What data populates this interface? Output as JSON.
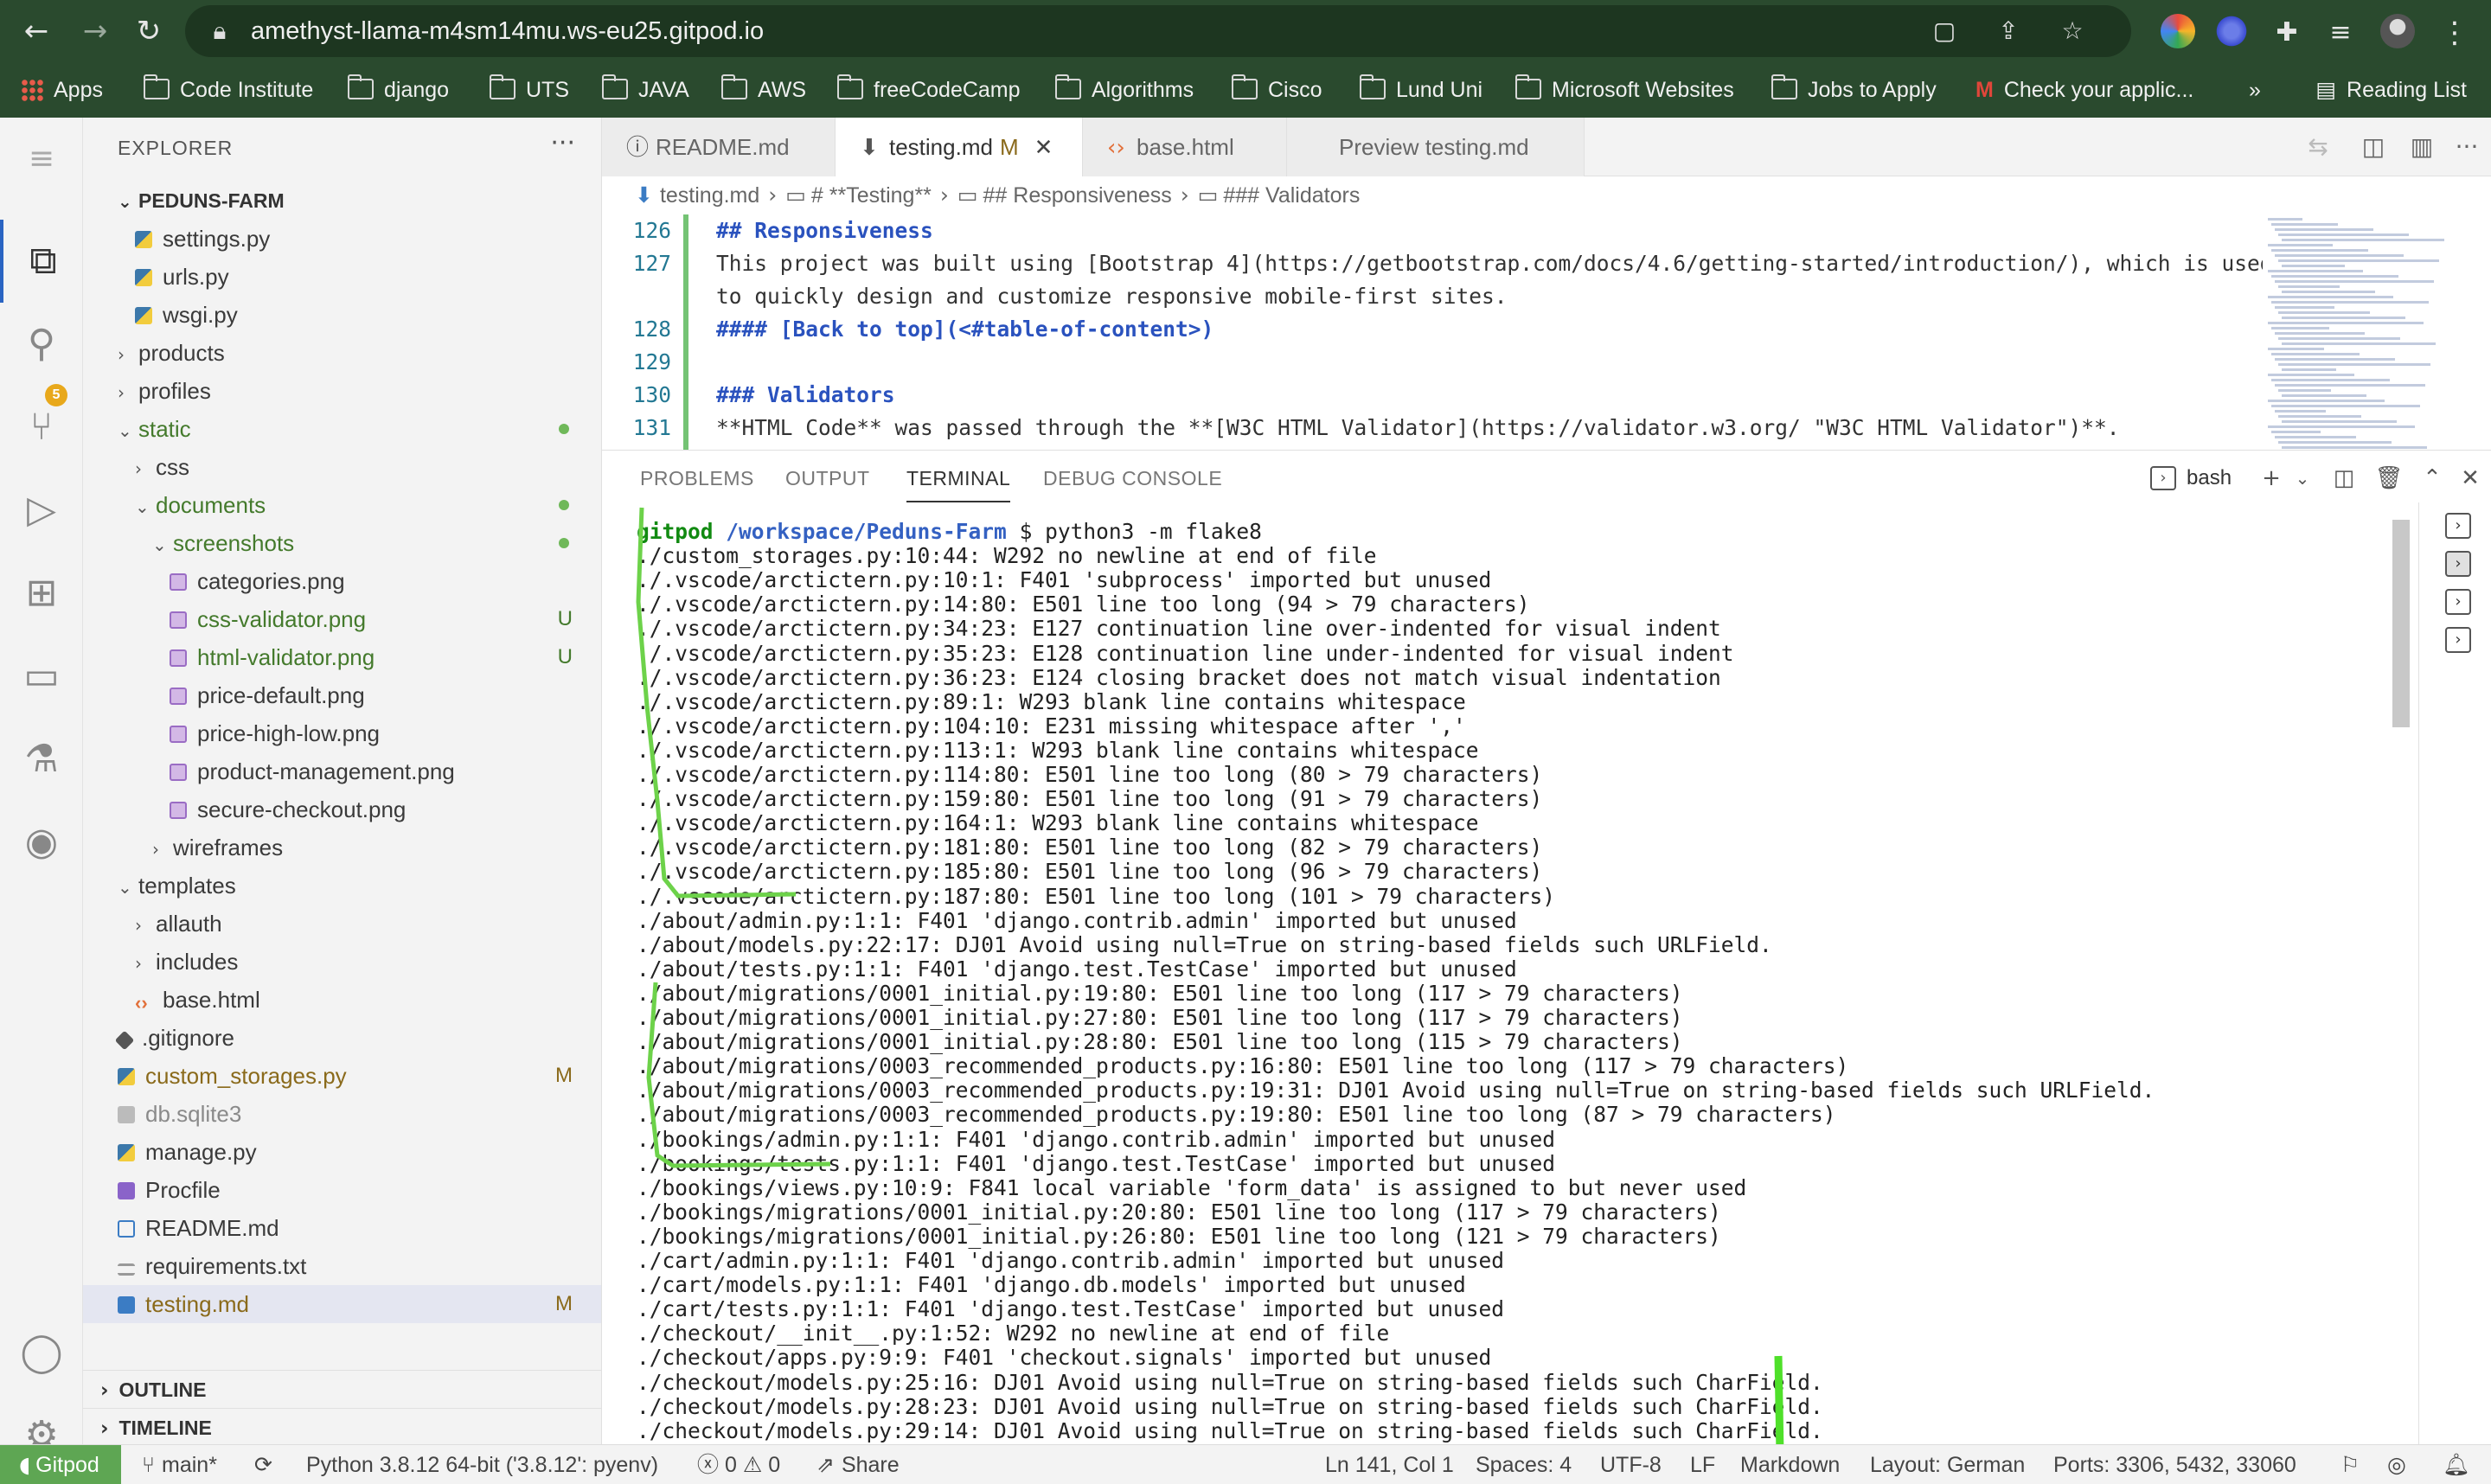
{
  "browser": {
    "url": "amethyst-llama-m4sm14mu.ws-eu25.gitpod.io",
    "bookmarks": [
      "Apps",
      "Code Institute",
      "django",
      "UTS",
      "JAVA",
      "AWS",
      "freeCodeCamp",
      "Algorithms",
      "Cisco",
      "Lund Uni",
      "Microsoft Websites",
      "Jobs to Apply",
      "Check your applic..."
    ],
    "overflow": "»",
    "reading_list": "Reading List"
  },
  "activity_bar": {
    "scm_badge": "5"
  },
  "explorer": {
    "title": "EXPLORER",
    "project": "PEDUNS-FARM",
    "rows": [
      {
        "label": "settings.py",
        "indent": 1,
        "icon": "py",
        "chev": ""
      },
      {
        "label": "urls.py",
        "indent": 1,
        "icon": "py",
        "chev": ""
      },
      {
        "label": "wsgi.py",
        "indent": 1,
        "icon": "py",
        "chev": ""
      },
      {
        "label": "products",
        "indent": 0,
        "icon": "",
        "chev": "›"
      },
      {
        "label": "profiles",
        "indent": 0,
        "icon": "",
        "chev": "›"
      },
      {
        "label": "static",
        "indent": 0,
        "icon": "",
        "chev": "⌄",
        "color": "green",
        "dot": true
      },
      {
        "label": "css",
        "indent": 1,
        "icon": "",
        "chev": "›"
      },
      {
        "label": "documents",
        "indent": 1,
        "icon": "",
        "chev": "⌄",
        "color": "green",
        "dot": true
      },
      {
        "label": "screenshots",
        "indent": 2,
        "icon": "",
        "chev": "⌄",
        "color": "green",
        "dot": true
      },
      {
        "label": "categories.png",
        "indent": 3,
        "icon": "img",
        "chev": ""
      },
      {
        "label": "css-validator.png",
        "indent": 3,
        "icon": "img",
        "chev": "",
        "color": "green",
        "badge": "U"
      },
      {
        "label": "html-validator.png",
        "indent": 3,
        "icon": "img",
        "chev": "",
        "color": "green",
        "badge": "U"
      },
      {
        "label": "price-default.png",
        "indent": 3,
        "icon": "img",
        "chev": ""
      },
      {
        "label": "price-high-low.png",
        "indent": 3,
        "icon": "img",
        "chev": ""
      },
      {
        "label": "product-management.png",
        "indent": 3,
        "icon": "img",
        "chev": ""
      },
      {
        "label": "secure-checkout.png",
        "indent": 3,
        "icon": "img",
        "chev": ""
      },
      {
        "label": "wireframes",
        "indent": 2,
        "icon": "",
        "chev": "›"
      },
      {
        "label": "templates",
        "indent": 0,
        "icon": "",
        "chev": "⌄"
      },
      {
        "label": "allauth",
        "indent": 1,
        "icon": "",
        "chev": "›"
      },
      {
        "label": "includes",
        "indent": 1,
        "icon": "",
        "chev": "›"
      },
      {
        "label": "base.html",
        "indent": 1,
        "icon": "html",
        "chev": ""
      },
      {
        "label": ".gitignore",
        "indent": 0,
        "icon": "git",
        "chev": ""
      },
      {
        "label": "custom_storages.py",
        "indent": 0,
        "icon": "py",
        "chev": "",
        "color": "modified",
        "badge": "M"
      },
      {
        "label": "db.sqlite3",
        "indent": 0,
        "icon": "db",
        "chev": "",
        "color": "muted"
      },
      {
        "label": "manage.py",
        "indent": 0,
        "icon": "py",
        "chev": ""
      },
      {
        "label": "Procfile",
        "indent": 0,
        "icon": "proc",
        "chev": ""
      },
      {
        "label": "README.md",
        "indent": 0,
        "icon": "info",
        "chev": ""
      },
      {
        "label": "requirements.txt",
        "indent": 0,
        "icon": "txt",
        "chev": ""
      },
      {
        "label": "testing.md",
        "indent": 0,
        "icon": "md",
        "chev": "",
        "color": "modified",
        "badge": "M",
        "selected": true
      }
    ],
    "outline": "OUTLINE",
    "timeline": "TIMELINE"
  },
  "tabs": [
    {
      "label": "README.md",
      "icon": "ⓘ",
      "active": false
    },
    {
      "label": "testing.md",
      "icon": "⬇",
      "active": true,
      "flag": "M"
    },
    {
      "label": "base.html",
      "icon": "‹›",
      "active": false
    },
    {
      "label": "Preview testing.md",
      "icon": "",
      "active": false
    }
  ],
  "breadcrumb": [
    "testing.md",
    "# **Testing**",
    "## Responsiveness",
    "### Validators"
  ],
  "code_lines": [
    {
      "num": "126",
      "text": "## Responsiveness",
      "kind": "head"
    },
    {
      "num": "127",
      "text": "This project was built using [Bootstrap 4](https://getbootstrap.com/docs/4.6/getting-started/introduction/), which is used",
      "kind": "para"
    },
    {
      "num": "",
      "text": "to quickly design and customize responsive mobile-first sites.",
      "kind": "para"
    },
    {
      "num": "128",
      "text": "#### [Back to top](<#table-of-content>)",
      "kind": "head"
    },
    {
      "num": "129",
      "text": "",
      "kind": "para"
    },
    {
      "num": "130",
      "text": "### Validators",
      "kind": "head"
    },
    {
      "num": "131",
      "text": "**HTML Code** was passed through the **[W3C HTML Validator](https://validator.w3.org/ \"W3C HTML Validator\")**.",
      "kind": "bold"
    }
  ],
  "panel": {
    "tabs": [
      "PROBLEMS",
      "OUTPUT",
      "TERMINAL",
      "DEBUG CONSOLE"
    ],
    "active": "TERMINAL",
    "shell": "bash"
  },
  "terminal": {
    "prompt_user": "gitpod",
    "prompt_path": "/workspace/Peduns-Farm",
    "command": "$ python3 -m flake8",
    "lines": [
      "./custom_storages.py:10:44: W292 no newline at end of file",
      "./.vscode/arctictern.py:10:1: F401 'subprocess' imported but unused",
      "./.vscode/arctictern.py:14:80: E501 line too long (94 > 79 characters)",
      "./.vscode/arctictern.py:34:23: E127 continuation line over-indented for visual indent",
      "./.vscode/arctictern.py:35:23: E128 continuation line under-indented for visual indent",
      "./.vscode/arctictern.py:36:23: E124 closing bracket does not match visual indentation",
      "./.vscode/arctictern.py:89:1: W293 blank line contains whitespace",
      "./.vscode/arctictern.py:104:10: E231 missing whitespace after ','",
      "./.vscode/arctictern.py:113:1: W293 blank line contains whitespace",
      "./.vscode/arctictern.py:114:80: E501 line too long (80 > 79 characters)",
      "./.vscode/arctictern.py:159:80: E501 line too long (91 > 79 characters)",
      "./.vscode/arctictern.py:164:1: W293 blank line contains whitespace",
      "./.vscode/arctictern.py:181:80: E501 line too long (82 > 79 characters)",
      "./.vscode/arctictern.py:185:80: E501 line too long (96 > 79 characters)",
      "./.vscode/arctictern.py:187:80: E501 line too long (101 > 79 characters)",
      "./about/admin.py:1:1: F401 'django.contrib.admin' imported but unused",
      "./about/models.py:22:17: DJ01 Avoid using null=True on string-based fields such URLField.",
      "./about/tests.py:1:1: F401 'django.test.TestCase' imported but unused",
      "./about/migrations/0001_initial.py:19:80: E501 line too long (117 > 79 characters)",
      "./about/migrations/0001_initial.py:27:80: E501 line too long (117 > 79 characters)",
      "./about/migrations/0001_initial.py:28:80: E501 line too long (115 > 79 characters)",
      "./about/migrations/0003_recommended_products.py:16:80: E501 line too long (117 > 79 characters)",
      "./about/migrations/0003_recommended_products.py:19:31: DJ01 Avoid using null=True on string-based fields such URLField.",
      "./about/migrations/0003_recommended_products.py:19:80: E501 line too long (87 > 79 characters)",
      "./bookings/admin.py:1:1: F401 'django.contrib.admin' imported but unused",
      "./bookings/tests.py:1:1: F401 'django.test.TestCase' imported but unused",
      "./bookings/views.py:10:9: F841 local variable 'form_data' is assigned to but never used",
      "./bookings/migrations/0001_initial.py:20:80: E501 line too long (117 > 79 characters)",
      "./bookings/migrations/0001_initial.py:26:80: E501 line too long (121 > 79 characters)",
      "./cart/admin.py:1:1: F401 'django.contrib.admin' imported but unused",
      "./cart/models.py:1:1: F401 'django.db.models' imported but unused",
      "./cart/tests.py:1:1: F401 'django.test.TestCase' imported but unused",
      "./checkout/__init__.py:1:52: W292 no newline at end of file",
      "./checkout/apps.py:9:9: F401 'checkout.signals' imported but unused",
      "./checkout/models.py:25:16: DJ01 Avoid using null=True on string-based fields such CharField.",
      "./checkout/models.py:28:23: DJ01 Avoid using null=True on string-based fields such CharField.",
      "./checkout/models.py:29:14: DJ01 Avoid using null=True on string-based fields such CharField."
    ]
  },
  "statusbar": {
    "remote": "Gitpod",
    "branch": "main*",
    "python": "Python 3.8.12 64-bit ('3.8.12': pyenv)",
    "errors": "0",
    "warnings": "0",
    "share": "Share",
    "position": "Ln 141, Col 1",
    "spaces": "Spaces: 4",
    "encoding": "UTF-8",
    "eol": "LF",
    "language": "Markdown",
    "layout": "Layout: German",
    "ports": "Ports: 3306, 5432, 33060"
  }
}
